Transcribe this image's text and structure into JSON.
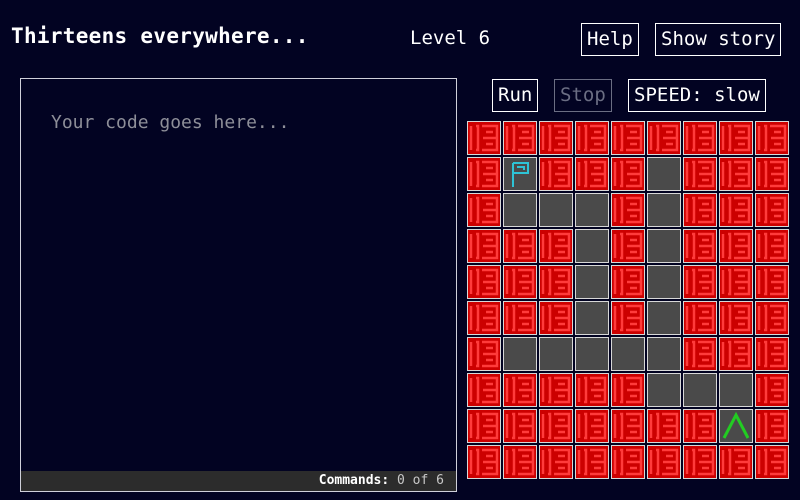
{
  "header": {
    "title": "Thirteens everywhere...",
    "level": "Level 6",
    "help_label": "Help",
    "story_label": "Show story"
  },
  "controls": {
    "run_label": "Run",
    "stop_label": "Stop",
    "speed_label": "SPEED: slow"
  },
  "editor": {
    "placeholder": "Your code goes here...",
    "value": "",
    "commands_label": "Commands:",
    "commands_value": "0 of 6"
  },
  "board": {
    "legend": {
      "T": "thirteen-block",
      "E": "empty-floor",
      "F": "goal-flag",
      "P": "player-arrow-up"
    },
    "rows": [
      "TTTTTTTTT",
      "TFTTTETTT",
      "TEEETETTT",
      "TTTETETTT",
      "TTTETETTT",
      "TTTETETTT",
      "TEEEEETTT",
      "TTTTTEEET",
      "TTTTTTTPT",
      "TTTTTTTTT"
    ],
    "colors": {
      "block_bg": "#cc0000",
      "block_glyph": "#ff3b3b",
      "floor": "#4a4a4a",
      "flag": "#2ec4d6",
      "player": "#22cc22"
    }
  }
}
